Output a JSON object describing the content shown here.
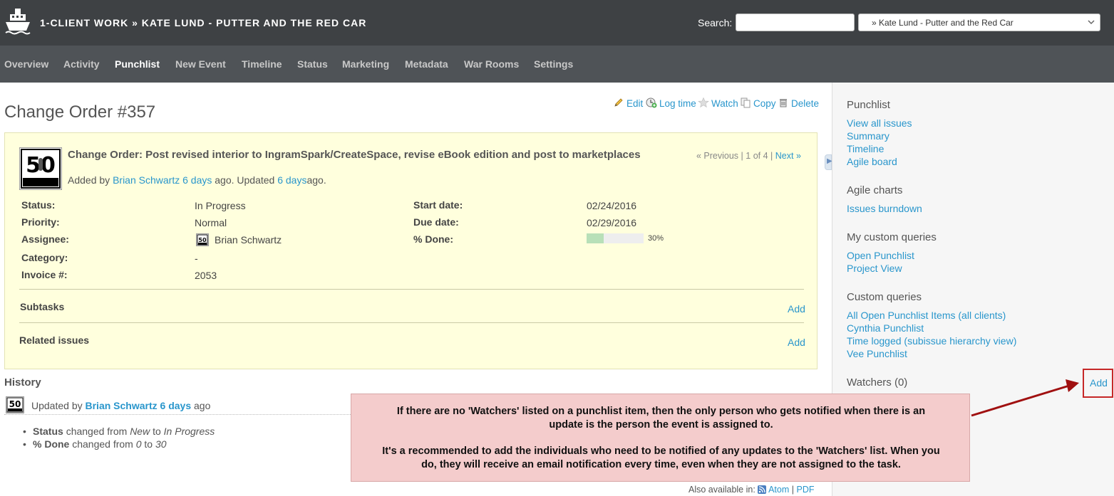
{
  "header": {
    "project_title": "1-CLIENT WORK » KATE LUND - PUTTER AND THE RED CAR",
    "search_label": "Search:",
    "search_value": "",
    "project_select": "» Kate Lund - Putter and the Red Car"
  },
  "menu": [
    {
      "label": "Overview"
    },
    {
      "label": "Activity"
    },
    {
      "label": "Punchlist",
      "selected": true
    },
    {
      "label": "New Event"
    },
    {
      "label": "Timeline"
    },
    {
      "label": "Status"
    },
    {
      "label": "Marketing"
    },
    {
      "label": "Metadata"
    },
    {
      "label": "War Rooms"
    },
    {
      "label": "Settings"
    }
  ],
  "contextual": {
    "edit": "Edit",
    "log_time": "Log time",
    "watch": "Watch",
    "copy": "Copy",
    "delete": "Delete"
  },
  "page_title": "Change Order #357",
  "issue": {
    "avatar_text": "50 Interviews",
    "subject": "Change Order: Post revised interior to IngramSpark/CreateSpace, revise eBook edition and post to marketplaces",
    "added_by_prefix": "Added by",
    "author": "Brian Schwartz",
    "created_ago": "6 days",
    "updated_mid": "ago. Updated",
    "updated_ago": "6 days",
    "ago_suffix": "ago.",
    "nav_previous": "« Previous",
    "nav_sep1": "|",
    "nav_position": "1 of 4",
    "nav_sep2": "|",
    "nav_next": "Next »",
    "attributes": {
      "status_label": "Status:",
      "status": "In Progress",
      "priority_label": "Priority:",
      "priority": "Normal",
      "assignee_label": "Assignee:",
      "assignee": "Brian Schwartz",
      "category_label": "Category:",
      "category": "-",
      "invoice_label": "Invoice #:",
      "invoice": "2053",
      "start_label": "Start date:",
      "start_date": "02/24/2016",
      "due_label": "Due date:",
      "due_date": "02/29/2016",
      "done_label": "% Done:",
      "done_percent": 30,
      "done_text": "30%"
    },
    "subtasks_label": "Subtasks",
    "subtasks_add": "Add",
    "related_label": "Related issues",
    "related_add": "Add"
  },
  "history": {
    "title": "History",
    "updated_by_prefix": "Updated by",
    "author": "Brian Schwartz",
    "time": "6 days",
    "ago": "ago",
    "changes": [
      {
        "field": "Status",
        "mid": "changed from",
        "from": "New",
        "to_word": "to",
        "to": "In Progress"
      },
      {
        "field": "% Done",
        "mid": "changed from",
        "from": "0",
        "to_word": "to",
        "to": "30"
      }
    ]
  },
  "also_available": {
    "prefix": "Also available in:",
    "atom": "Atom",
    "sep": "|",
    "pdf": "PDF"
  },
  "sidebar": {
    "punchlist_title": "Punchlist",
    "punchlist_links": [
      "View all issues",
      "Summary",
      "Timeline",
      "Agile board"
    ],
    "agile_title": "Agile charts",
    "agile_links": [
      "Issues burndown"
    ],
    "my_queries_title": "My custom queries",
    "my_queries_links": [
      "Open Punchlist",
      "Project View"
    ],
    "custom_queries_title": "Custom queries",
    "custom_queries_links": [
      "All Open Punchlist Items (all clients)",
      "Cynthia Punchlist",
      "Time logged (subissue hierarchy view)",
      "Vee Punchlist"
    ],
    "watchers_title": "Watchers (0)",
    "watchers_add": "Add"
  },
  "callout": {
    "line1": "If there are no 'Watchers' listed on a punchlist item, then the only person who gets notified when there is an",
    "line2": "update is the person the event is assigned to.",
    "line3": "It's a recommended to add the individuals who need to be notified of any updates to the 'Watchers' list. When you",
    "line4": "do, they will receive an email notification every time, even when they are not assigned to the task."
  },
  "colors": {
    "header_bg": "#3e4144",
    "menu_bg": "#4f5357",
    "link": "#2996cc",
    "issue_bg": "#ffffdd",
    "callout_bg": "#f4cccc",
    "annotation": "#c62828"
  }
}
